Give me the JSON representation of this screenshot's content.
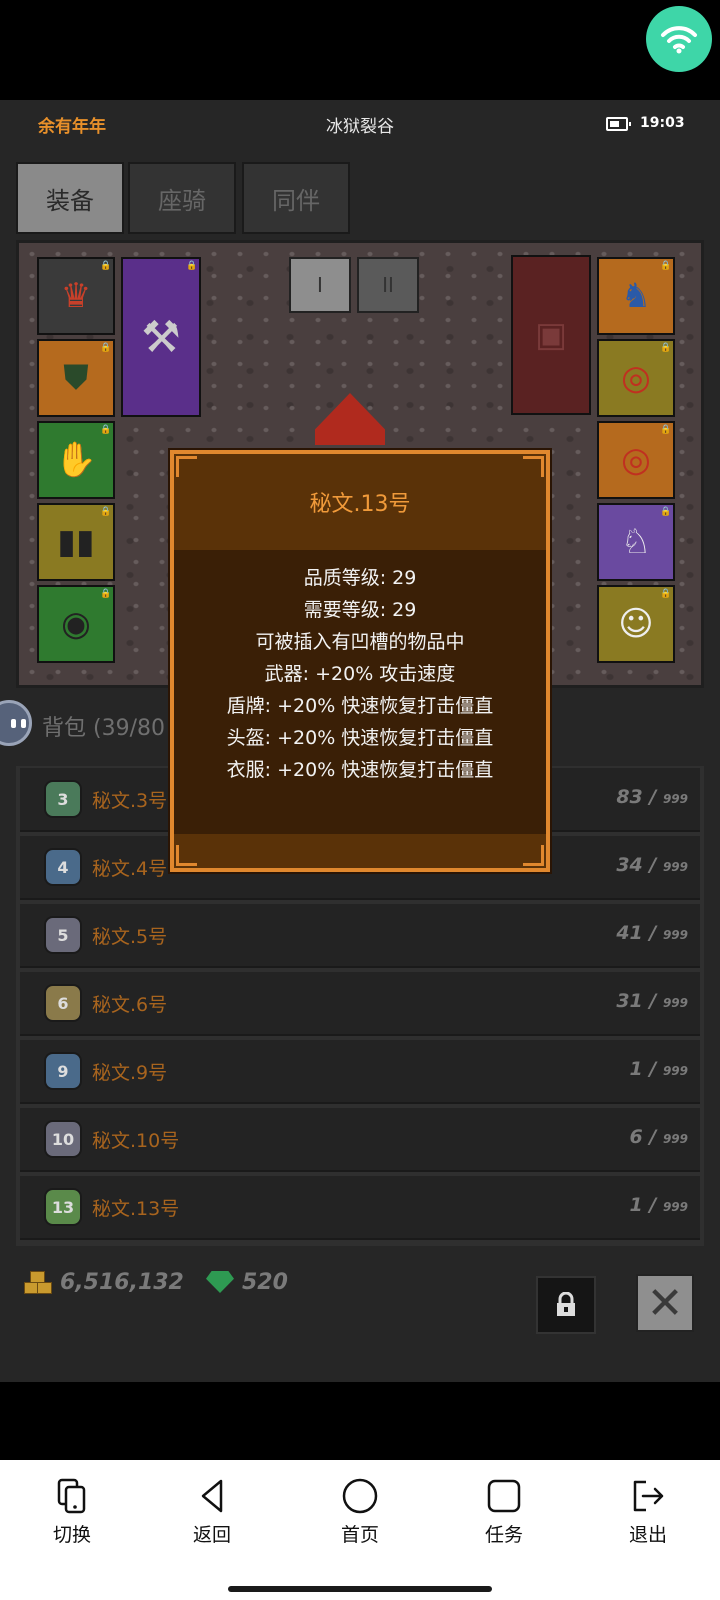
{
  "status": {
    "player": "余有年年",
    "zone": "冰狱裂谷",
    "time": "19:03"
  },
  "tabs": [
    {
      "label": "装备",
      "active": true
    },
    {
      "label": "座骑",
      "active": false
    },
    {
      "label": "同伴",
      "active": false
    }
  ],
  "set_tabs": [
    "I",
    "II"
  ],
  "tooltip": {
    "title": "秘文.13号",
    "lines": [
      "品质等级: 29",
      "需要等级: 29",
      "可被插入有凹槽的物品中",
      "武器: +20% 攻击速度",
      "盾牌: +20% 快速恢复打击僵直",
      "头盔: +20% 快速恢复打击僵直",
      "衣服: +20% 快速恢复打击僵直"
    ]
  },
  "bag": {
    "title": "背包 (39/80",
    "items": [
      {
        "icon": "3",
        "name": "秘文.3号",
        "count": "83 /",
        "max": "999",
        "color": "#4a7a5a"
      },
      {
        "icon": "4",
        "name": "秘文.4号",
        "count": "34 /",
        "max": "999",
        "color": "#4a6a8a"
      },
      {
        "icon": "5",
        "name": "秘文.5号",
        "count": "41 /",
        "max": "999",
        "color": "#6a6a7a"
      },
      {
        "icon": "6",
        "name": "秘文.6号",
        "count": "31 /",
        "max": "999",
        "color": "#8a7a4a"
      },
      {
        "icon": "9",
        "name": "秘文.9号",
        "count": "1 /",
        "max": "999",
        "color": "#4a6a8a"
      },
      {
        "icon": "10",
        "name": "秘文.10号",
        "count": "6 /",
        "max": "999",
        "color": "#6a6a7a"
      },
      {
        "icon": "13",
        "name": "秘文.13号",
        "count": "1 /",
        "max": "999",
        "color": "#5a8a4a"
      }
    ]
  },
  "currency": {
    "gold": "6,516,132",
    "gems": "520"
  },
  "nav": [
    {
      "label": "切换",
      "icon": "switch-icon"
    },
    {
      "label": "返回",
      "icon": "back-icon"
    },
    {
      "label": "首页",
      "icon": "home-icon"
    },
    {
      "label": "任务",
      "icon": "task-icon"
    },
    {
      "label": "退出",
      "icon": "exit-icon"
    }
  ]
}
